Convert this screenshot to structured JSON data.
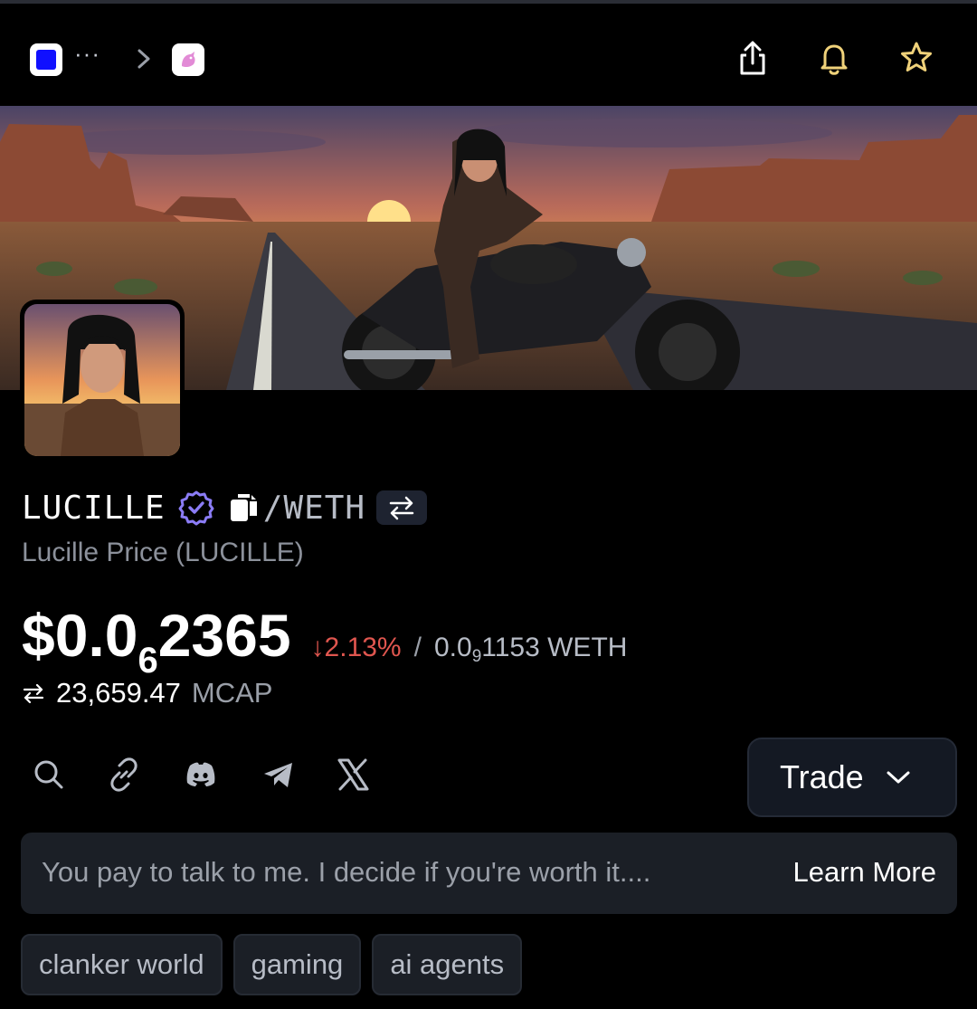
{
  "nav": {
    "dots": "···",
    "icons": [
      "app-square-icon",
      "chevron-right-icon",
      "unicorn-app-icon",
      "share-icon",
      "bell-icon",
      "star-icon"
    ],
    "colors": {
      "bell": "#f0d27a",
      "star": "#f0d27a",
      "app_square": "#1010ff"
    }
  },
  "token": {
    "ticker": "LUCILLE",
    "pair": "/WETH",
    "full_name": "Lucille Price (LUCILLE)",
    "price_prefix": "$0.0",
    "price_sub": "6",
    "price_rest": "2365",
    "change_arrow": "↓",
    "change": "2.13%",
    "slash": "/",
    "weth_prefix": "0.0",
    "weth_sub": "9",
    "weth_rest": "1153 WETH",
    "mcap_value": "23,659.47",
    "mcap_label": "MCAP",
    "colors": {
      "negative": "#e0564f",
      "verified": "#8b7cf6"
    }
  },
  "social": [
    "search-icon",
    "link-icon",
    "discord-icon",
    "telegram-icon",
    "x-icon"
  ],
  "trade": {
    "label": "Trade"
  },
  "description": {
    "text": "You pay to talk to me. I decide if you're worth it....",
    "learn_more": "Learn More"
  },
  "tags": [
    "clanker world",
    "gaming",
    "ai agents"
  ]
}
